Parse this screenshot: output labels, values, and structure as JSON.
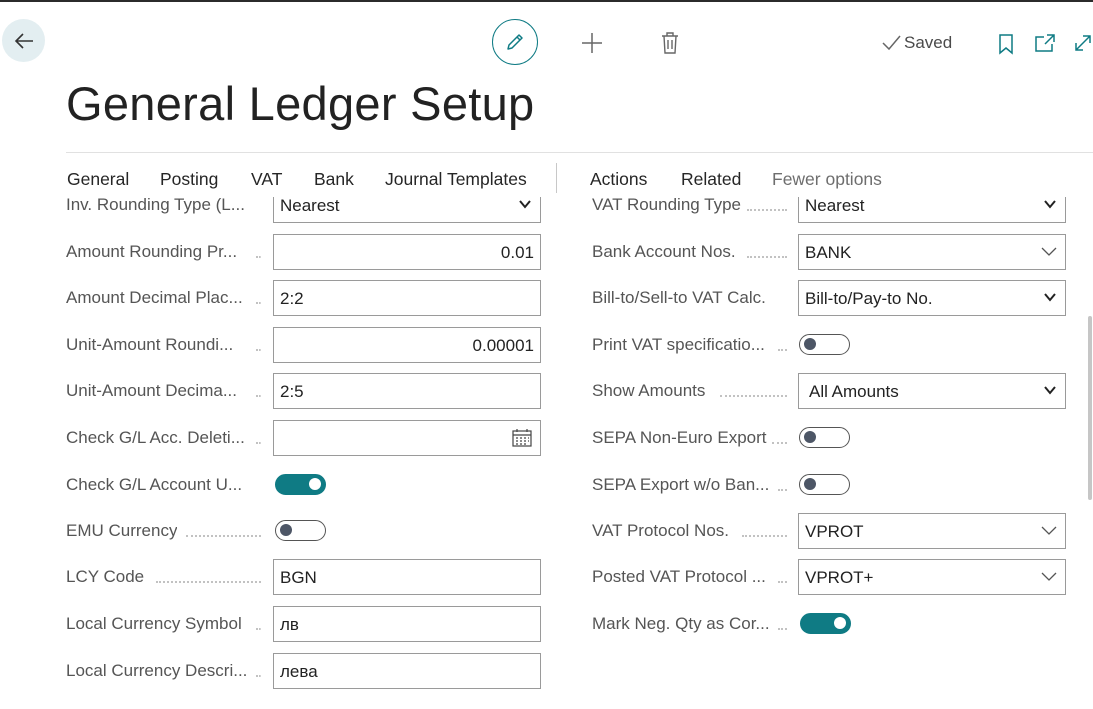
{
  "header": {
    "title": "General Ledger Setup",
    "saved_label": "Saved",
    "icons": [
      "back-arrow-icon",
      "pencil-icon",
      "plus-icon",
      "trash-icon",
      "checkmark-icon",
      "bookmark-icon",
      "open-new-window-icon",
      "expand-icon"
    ]
  },
  "menu": {
    "items": [
      "General",
      "Posting",
      "VAT",
      "Bank",
      "Journal Templates"
    ],
    "actions": [
      "Actions",
      "Related",
      "Fewer options"
    ]
  },
  "left_fields": [
    {
      "label": "Inv. Rounding Type (L...",
      "type": "select",
      "value": "Nearest"
    },
    {
      "label": "Amount Rounding Pr...",
      "type": "number",
      "value": "0.01"
    },
    {
      "label": "Amount Decimal Plac...",
      "type": "text",
      "value": "2:2"
    },
    {
      "label": "Unit-Amount Roundi...",
      "type": "number",
      "value": "0.00001"
    },
    {
      "label": "Unit-Amount Decima...",
      "type": "text",
      "value": "2:5"
    },
    {
      "label": "Check G/L Acc. Deleti...",
      "type": "date",
      "value": ""
    },
    {
      "label": "Check G/L Account U...",
      "type": "toggle",
      "value": true
    },
    {
      "label": "EMU Currency",
      "type": "toggle",
      "value": false
    },
    {
      "label": "LCY Code",
      "type": "text",
      "value": "BGN"
    },
    {
      "label": "Local Currency Symbol",
      "type": "text",
      "value": "лв"
    },
    {
      "label": "Local Currency Descri...",
      "type": "text",
      "value": "лева"
    }
  ],
  "right_fields": [
    {
      "label": "VAT Rounding Type",
      "type": "select",
      "value": "Nearest"
    },
    {
      "label": "Bank Account Nos.",
      "type": "lookup",
      "value": "BANK"
    },
    {
      "label": "Bill-to/Sell-to VAT Calc.",
      "type": "select",
      "value": "Bill-to/Pay-to No."
    },
    {
      "label": "Print VAT specificatio...",
      "type": "toggle",
      "value": false
    },
    {
      "label": "Show Amounts",
      "type": "select",
      "value": "All Amounts"
    },
    {
      "label": "SEPA Non-Euro Export",
      "type": "toggle",
      "value": false
    },
    {
      "label": "SEPA Export w/o Ban...",
      "type": "toggle",
      "value": false
    },
    {
      "label": "VAT Protocol Nos.",
      "type": "lookup",
      "value": "VPROT"
    },
    {
      "label": "Posted VAT Protocol ...",
      "type": "lookup",
      "value": "VPROT+"
    },
    {
      "label": "Mark Neg. Qty as Cor...",
      "type": "toggle",
      "value": true
    }
  ],
  "colors": {
    "accent": "#0f7b84",
    "back_button_bg": "#e3eef1"
  }
}
